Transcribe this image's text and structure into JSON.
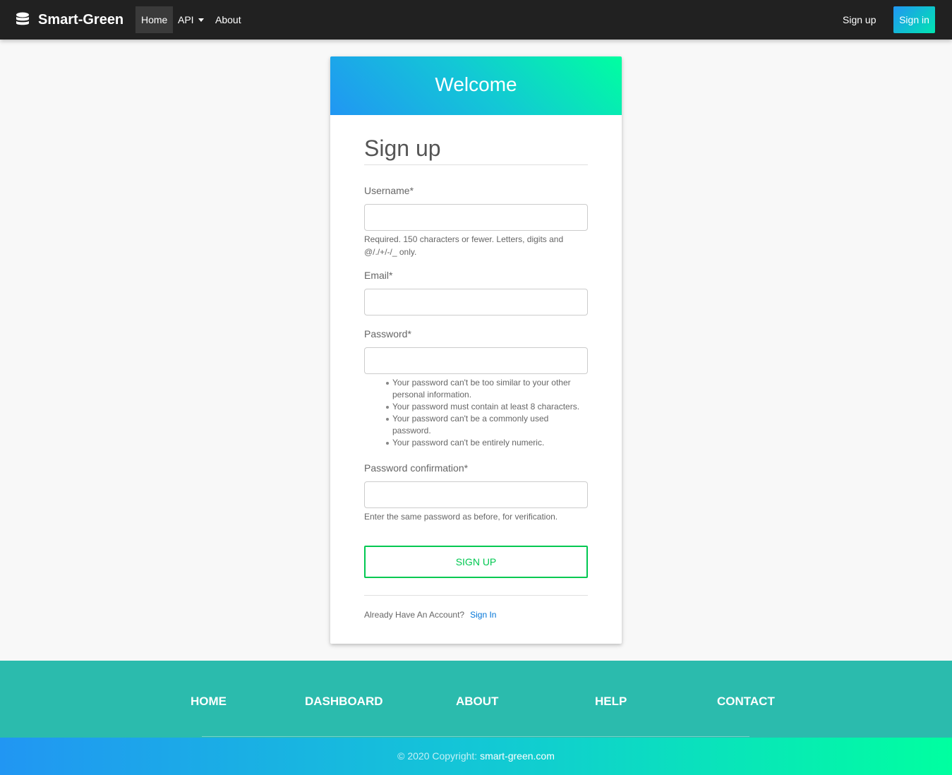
{
  "navbar": {
    "brand": "Smart-Green",
    "items": [
      "Home",
      "API",
      "About"
    ],
    "signup": "Sign up",
    "signin": "Sign in"
  },
  "card": {
    "header": "Welcome",
    "title": "Sign up",
    "username_label": "Username*",
    "username_help": "Required. 150 characters or fewer. Letters, digits and @/./+/-/_ only.",
    "email_label": "Email*",
    "password_label": "Password*",
    "password_rules": [
      "Your password can't be too similar to your other personal information.",
      "Your password must contain at least 8 characters.",
      "Your password can't be a commonly used password.",
      "Your password can't be entirely numeric."
    ],
    "confirm_label": "Password confirmation*",
    "confirm_help": "Enter the same password as before, for verification.",
    "submit": "SIGN UP",
    "already": "Already Have An Account?",
    "signin_link": "Sign In"
  },
  "footer": {
    "links": [
      "HOME",
      "DASHBOARD",
      "ABOUT",
      "HELP",
      "CONTACT"
    ],
    "copyright_prefix": "© 2020 Copyright:",
    "copyright_site": "smart-green.com"
  },
  "colors": {
    "navbar": "#212121",
    "footer": "#2bbbad",
    "submit": "#00c851",
    "link": "#0275d8"
  }
}
